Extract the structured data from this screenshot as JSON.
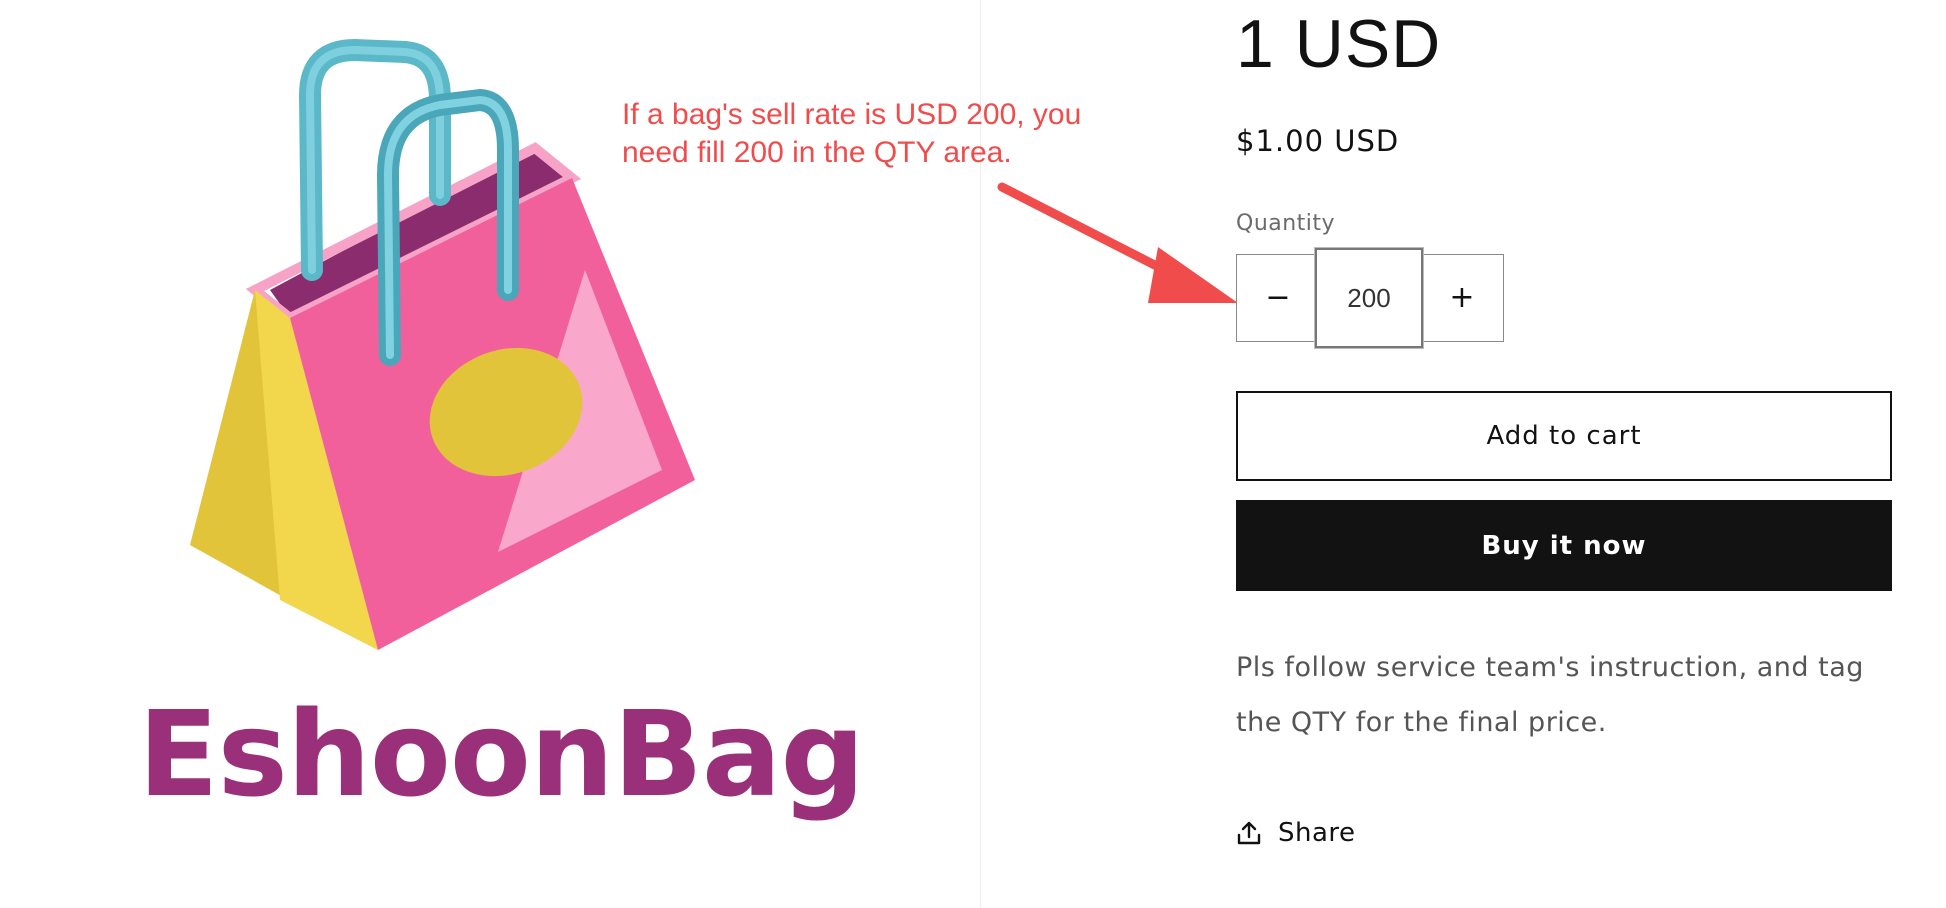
{
  "brand": {
    "name": "EshoonBag"
  },
  "annotation": {
    "text": "If a bag's sell rate is USD 200, you\n need fill 200 in the QTY area."
  },
  "product": {
    "title": "1 USD",
    "price": "$1.00 USD",
    "quantity_label": "Quantity",
    "quantity_value": "200",
    "minus_symbol": "−",
    "plus_symbol": "+",
    "add_to_cart_label": "Add to cart",
    "buy_now_label": "Buy it now",
    "description": "Pls follow service team's instruction, and tag the QTY for the final price.",
    "share_label": "Share"
  },
  "colors": {
    "annotation": "#f04c4c",
    "brand_text": "#9a2f7a",
    "bag_pink": "#f2609c",
    "bag_yellow": "#f2d64b",
    "handle_teal": "#5ab8c9",
    "button_dark": "#121212"
  },
  "icons": {
    "share": "share-icon",
    "arrow": "annotation-arrow-icon"
  }
}
